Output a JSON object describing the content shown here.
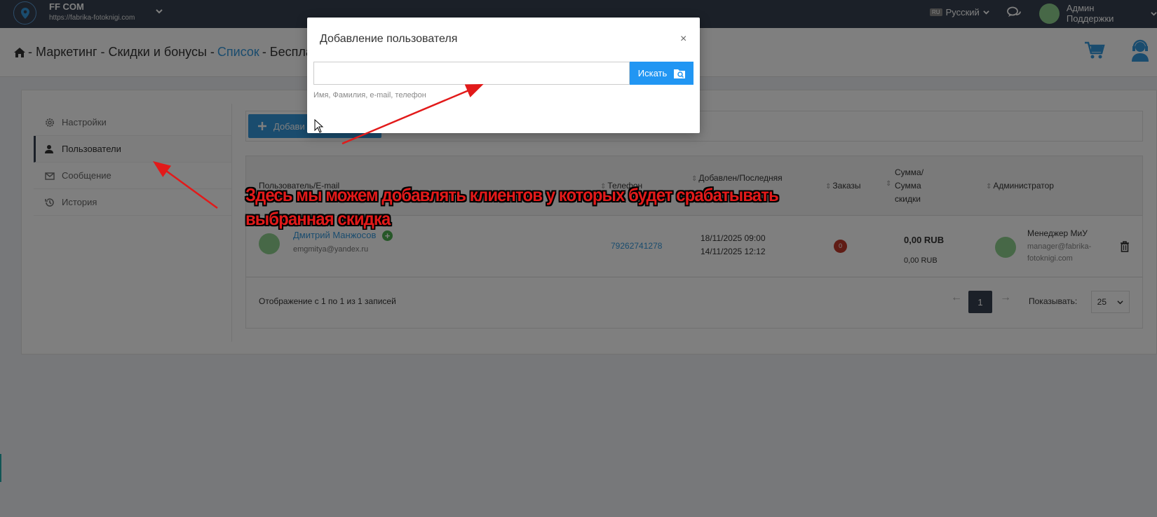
{
  "topbar": {
    "company_name": "FF COM",
    "company_url": "https://fabrika-fotoknigi.com",
    "language_flag": "RU",
    "language": "Русский",
    "user_name": "Админ Поддержки"
  },
  "breadcrumb": {
    "section": "- Маркетинг - Скидки и бонусы -",
    "list_link": "Список",
    "current": "- Бесплат"
  },
  "sidebar": {
    "items": [
      {
        "label": "Настройки",
        "icon": "gear-icon"
      },
      {
        "label": "Пользователи",
        "icon": "user-icon",
        "active": true
      },
      {
        "label": "Сообщение",
        "icon": "envelope-icon"
      },
      {
        "label": "История",
        "icon": "history-icon"
      }
    ]
  },
  "toolbar": {
    "add_label": "Добави"
  },
  "table": {
    "headers": {
      "user": "Пользователь/E-mail",
      "phone": "Телефон",
      "added": "Добавлен/Последняя",
      "orders": "Заказы",
      "sum_line1": "Сумма/",
      "sum_line2": "Сумма",
      "sum_line3": "скидки",
      "admin": "Администратор"
    },
    "rows": [
      {
        "name": "Дмитрий Манжосов",
        "email": "emgmitya@yandex.ru",
        "phone": "79262741278",
        "added": "18/11/2025 09:00",
        "last": "14/11/2025 12:12",
        "orders": "0",
        "sum": "0,00 RUB",
        "discount": "0,00 RUB",
        "manager_name": "Менеджер МиУ",
        "manager_email": "manager@fabrika-fotoknigi.com"
      }
    ],
    "footer_info": "Отображение с 1 по 1 из 1 записей",
    "prev": "←",
    "next": "→",
    "current_page": "1",
    "show_label": "Показывать:",
    "page_size": "25"
  },
  "modal": {
    "title": "Добавление пользователя",
    "close": "×",
    "search_value": "",
    "search_button": "Искать",
    "help_text": "Имя, Фамилия, e-mail, телефон"
  },
  "annotation": {
    "text": "Здесь мы можем добавлять клиентов у которых будет срабатывать выбранная скидка",
    "color": "#e21a1a"
  },
  "colors": {
    "topbar": "#364150",
    "accent": "#3598dc",
    "search_button": "#2196f3",
    "badge": "#c0392b"
  }
}
